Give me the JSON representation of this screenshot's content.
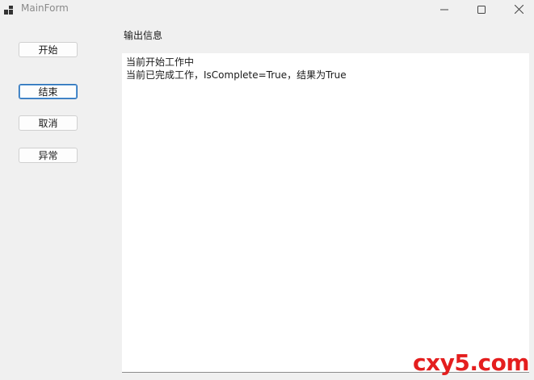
{
  "window": {
    "title": "MainForm",
    "controls": {
      "minimize_icon": "minimize-icon",
      "maximize_icon": "maximize-icon",
      "close_icon": "close-icon"
    }
  },
  "buttons": {
    "start": "开始",
    "end": "结束",
    "cancel": "取消",
    "error": "异常"
  },
  "output": {
    "label": "输出信息",
    "lines": [
      "当前开始工作中",
      "当前已完成工作，IsComplete=True，结果为True"
    ]
  },
  "watermark": "cxy5.com",
  "colors": {
    "focus_border": "#2b6fb6",
    "watermark": "#e41e1e",
    "background": "#f0f0f0"
  }
}
